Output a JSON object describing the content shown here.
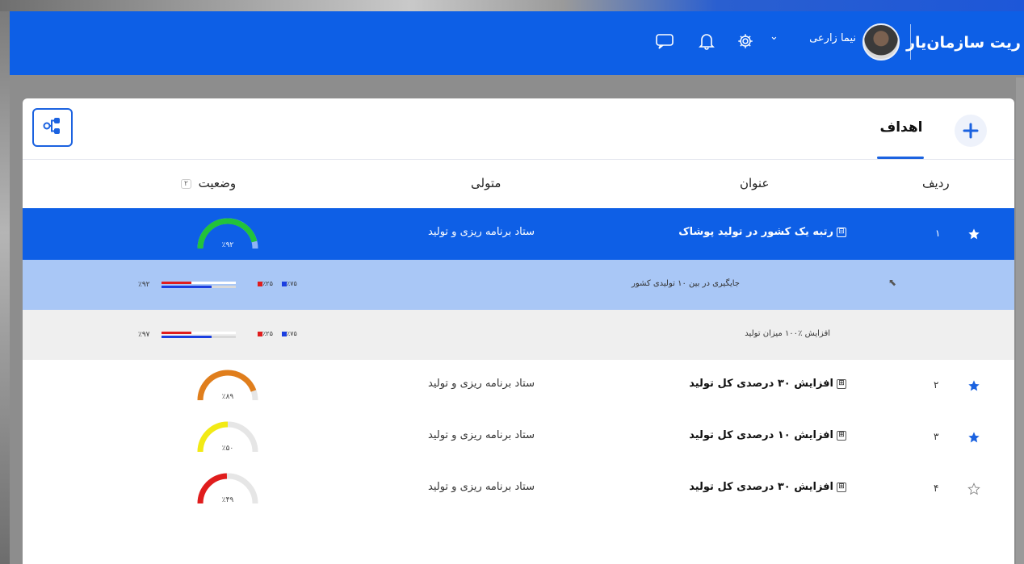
{
  "header": {
    "brand": "ریت سازمان‌یار",
    "user_name": "نیما زارعی",
    "colors": {
      "bar": "#0d5fe6"
    }
  },
  "tabs": [
    {
      "label": "اهداف",
      "active": true
    }
  ],
  "table": {
    "columns": {
      "index": "ردیف",
      "title": "عنوان",
      "owner": "متولی",
      "status": "وضعیت",
      "status_count": "۲"
    },
    "rows": [
      {
        "index": "۱",
        "starred": true,
        "title": "رتبه یک کشور در تولید پوشاک",
        "expand": "⊟",
        "owner": "ستاد برنامه ریزی و تولید",
        "percent": 92,
        "percent_label": "٪۹۲",
        "gauge_color": "#22c33a",
        "selected": true
      },
      {
        "index": "۲",
        "starred": true,
        "title": "افزایش ۳۰ درصدی کل تولید",
        "expand": "⊞",
        "owner": "ستاد برنامه ریزی و تولید",
        "percent": 89,
        "percent_label": "٪۸۹",
        "gauge_color": "#e07e1c"
      },
      {
        "index": "۳",
        "starred": true,
        "title": "افزایش ۱۰ درصدی کل تولید",
        "expand": "⊞",
        "owner": "ستاد برنامه ریزی و تولید",
        "percent": 50,
        "percent_label": "٪۵۰",
        "gauge_color": "#f2ea15"
      },
      {
        "index": "۴",
        "starred": false,
        "title": "افزایش ۳۰ درصدی کل تولید",
        "expand": "⊞",
        "owner": "ستاد برنامه ریزی و تولید",
        "percent": 49,
        "percent_label": "٪۴۹",
        "gauge_color": "#e01d1d"
      }
    ],
    "subrows": [
      {
        "title": "جایگیری در بین ۱۰ تولیدی کشور",
        "percent_label": "٪۹۲",
        "legend_a": "٪۷۵",
        "legend_b": "٪۲۵",
        "blue_fraction": 0.75,
        "red_fraction": 0.25
      },
      {
        "title": "افزایش ٪۱۰۰ میزان تولید",
        "percent_label": "٪۹۷",
        "legend_a": "٪۷۵",
        "legend_b": "٪۲۵",
        "blue_fraction": 0.75,
        "red_fraction": 0.25
      }
    ]
  }
}
